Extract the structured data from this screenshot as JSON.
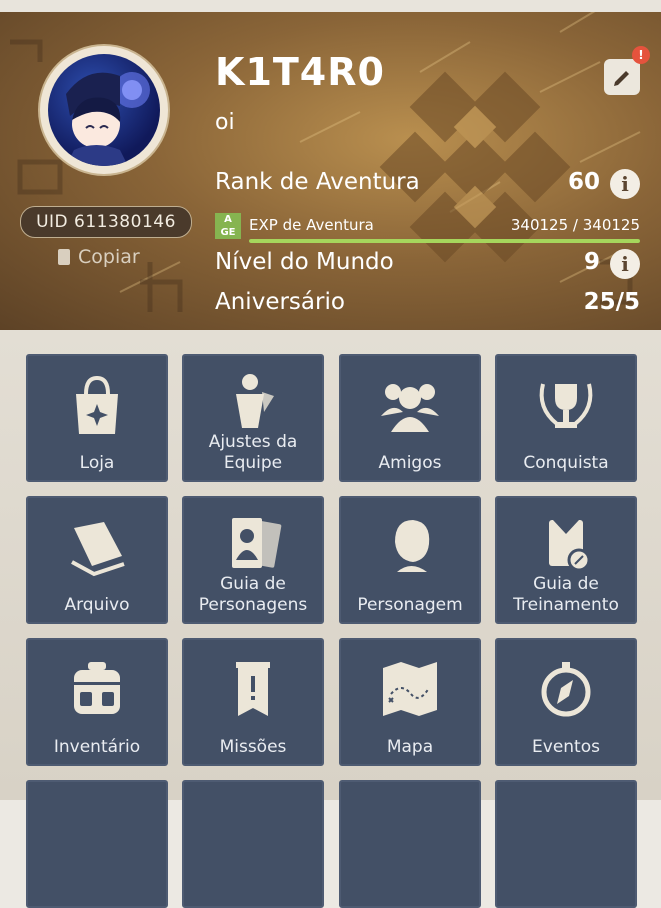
{
  "profile": {
    "username": "K1T4R0",
    "signature": "oi",
    "uid": "UID 611380146",
    "copy_label": "Copiar",
    "edit_badge": "!",
    "rank": {
      "label": "Rank de Aventura",
      "value": "60",
      "info": "i"
    },
    "exp": {
      "badge": "A\nGE",
      "label": "EXP de Aventura",
      "value": "340125 / 340125",
      "progress": 1.0
    },
    "world": {
      "label": "Nível do Mundo",
      "value": "9",
      "info": "i"
    },
    "birthday": {
      "label": "Aniversário",
      "value": "25/5"
    }
  },
  "menu": [
    {
      "label": "Loja",
      "icon": "shopping-bag-icon"
    },
    {
      "label": "Ajustes da Equipe",
      "icon": "team-setup-icon"
    },
    {
      "label": "Amigos",
      "icon": "friends-icon"
    },
    {
      "label": "Conquista",
      "icon": "trophy-icon"
    },
    {
      "label": "Arquivo",
      "icon": "archive-book-icon"
    },
    {
      "label": "Guia de Personagens",
      "icon": "character-cards-icon"
    },
    {
      "label": "Personagem",
      "icon": "character-portrait-icon"
    },
    {
      "label": "Guia de Treinamento",
      "icon": "training-guide-icon"
    },
    {
      "label": "Inventário",
      "icon": "backpack-icon"
    },
    {
      "label": "Missões",
      "icon": "quest-banner-icon"
    },
    {
      "label": "Mapa",
      "icon": "map-icon"
    },
    {
      "label": "Eventos",
      "icon": "compass-icon"
    }
  ],
  "colors": {
    "tile_bg": "#435066",
    "exp_bar": "#a6d65c",
    "alert_dot": "#e5533d"
  }
}
